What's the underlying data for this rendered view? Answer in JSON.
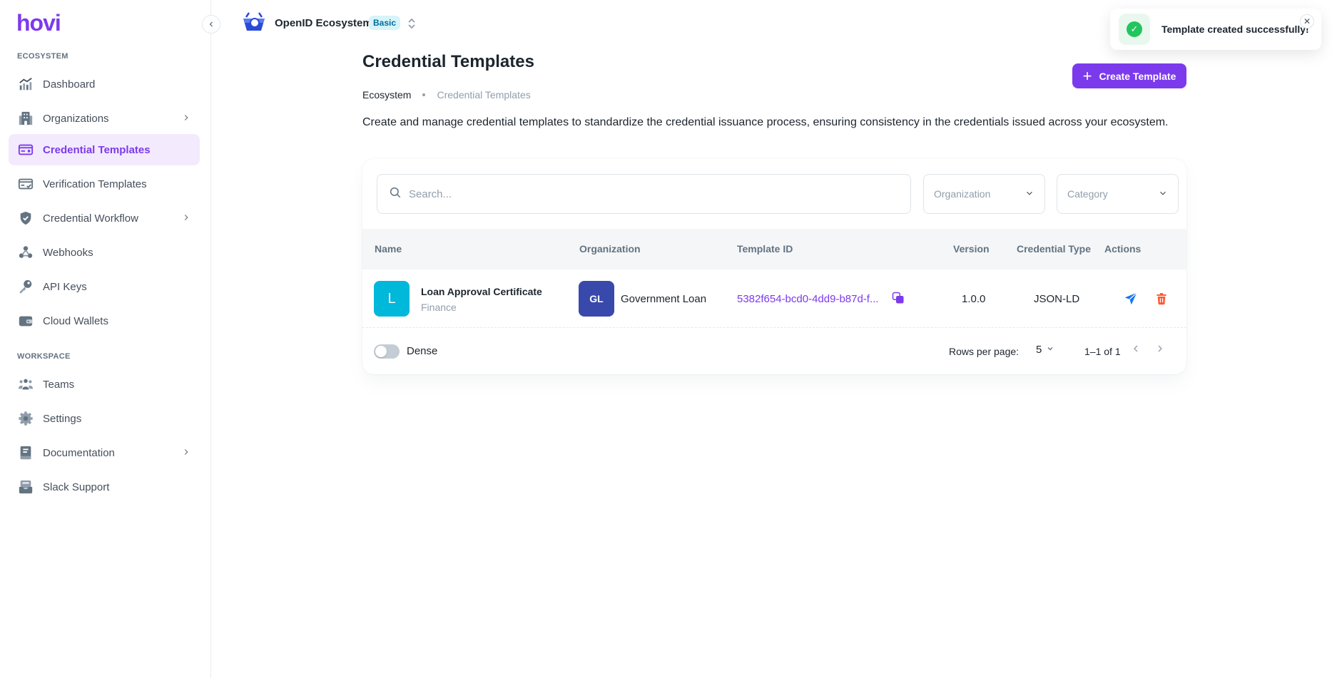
{
  "app": {
    "logo": "hovi",
    "ecosystem_name": "OpenID Ecosystem",
    "plan_badge": "Basic"
  },
  "sidebar": {
    "section_ecosystem": "ECOSYSTEM",
    "section_workspace": "WORKSPACE",
    "items": [
      {
        "label": "Dashboard",
        "icon": "chart-icon"
      },
      {
        "label": "Organizations",
        "icon": "building-icon",
        "has_submenu": true
      },
      {
        "label": "Credential Templates",
        "icon": "credential-card-icon",
        "active": true
      },
      {
        "label": "Verification Templates",
        "icon": "verification-card-icon"
      },
      {
        "label": "Credential Workflow",
        "icon": "shield-icon",
        "has_submenu": true
      },
      {
        "label": "Webhooks",
        "icon": "webhook-icon"
      },
      {
        "label": "API Keys",
        "icon": "key-icon"
      },
      {
        "label": "Cloud Wallets",
        "icon": "wallet-icon"
      }
    ],
    "workspace_items": [
      {
        "label": "Teams",
        "icon": "team-icon"
      },
      {
        "label": "Settings",
        "icon": "gear-icon"
      },
      {
        "label": "Documentation",
        "icon": "book-icon",
        "has_submenu": true
      },
      {
        "label": "Slack Support",
        "icon": "inbox-icon"
      }
    ]
  },
  "toast": {
    "message": "Template created successfully!",
    "type": "success"
  },
  "page": {
    "title": "Credential Templates",
    "create_button": "Create Template",
    "breadcrumb": [
      "Ecosystem",
      "Credential Templates"
    ],
    "description": "Create and manage credential templates to standardize the credential issuance process, ensuring consistency in the credentials issued across your ecosystem."
  },
  "filters": {
    "search_placeholder": "Search...",
    "organization_placeholder": "Organization",
    "category_placeholder": "Category"
  },
  "table": {
    "columns": [
      "Name",
      "Organization",
      "Template ID",
      "Version",
      "Credential Type",
      "Actions"
    ],
    "rows": [
      {
        "avatar_letter": "L",
        "name": "Loan Approval Certificate",
        "category": "Finance",
        "org_initials": "GL",
        "organization": "Government Loan",
        "template_id": "5382f654-bcd0-4dd9-b87d-f...",
        "version": "1.0.0",
        "credential_type": "JSON-LD"
      }
    ]
  },
  "pagination": {
    "dense_label": "Dense",
    "dense_on": false,
    "rows_per_page_label": "Rows per page:",
    "rows_per_page": "5",
    "range": "1–1 of 1"
  },
  "colors": {
    "primary": "#7c3aed",
    "avatar_template": "#00b8d9",
    "avatar_org": "#3949ab",
    "success": "#22c55e",
    "danger": "#ff5630",
    "send": "#1877f2"
  }
}
